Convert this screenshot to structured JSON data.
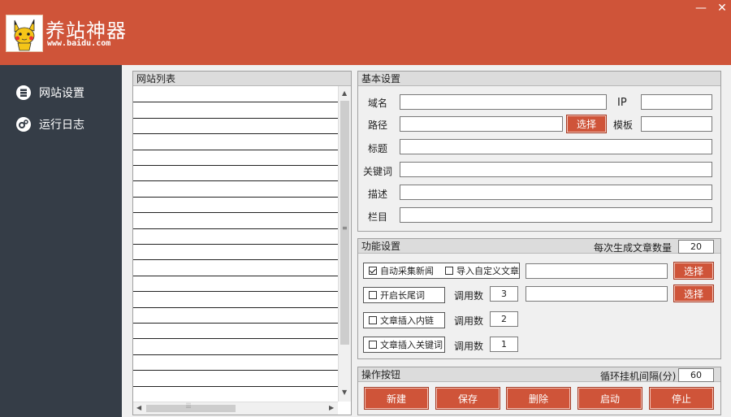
{
  "app": {
    "title": "养站神器",
    "url": "www.baidu.com",
    "minimize_glyph": "—",
    "close_glyph": "✕"
  },
  "sidebar": {
    "items": [
      {
        "label": "网站设置",
        "icon": "server-icon"
      },
      {
        "label": "运行日志",
        "icon": "gears-icon"
      }
    ]
  },
  "site_list": {
    "title": "网站列表",
    "row_count": 20
  },
  "basic": {
    "title": "基本设置",
    "domain_label": "域名",
    "domain_value": "",
    "ip_label": "IP",
    "ip_value": "",
    "path_label": "路径",
    "path_value": "",
    "select_label": "选择",
    "template_label": "模板",
    "template_value": "",
    "title_label": "标题",
    "title_value": "",
    "keywords_label": "关键词",
    "keywords_value": "",
    "desc_label": "描述",
    "desc_value": "",
    "column_label": "栏目",
    "column_value": ""
  },
  "func": {
    "title": "功能设置",
    "per_gen_label": "每次生成文章数量",
    "per_gen_value": "20",
    "auto_collect_label": "自动采集新闻",
    "auto_collect_checked": true,
    "import_custom_label": "导入自定义文章",
    "import_custom_checked": false,
    "select1_label": "选择",
    "select2_label": "选择",
    "longtail_label": "开启长尾词",
    "longtail_checked": false,
    "calls_label_1": "调用数",
    "calls_value_1": "3",
    "inner_link_label": "文章插入内链",
    "inner_link_checked": false,
    "calls_label_2": "调用数",
    "calls_value_2": "2",
    "insert_kw_label": "文章插入关键词",
    "insert_kw_checked": false,
    "calls_label_3": "调用数",
    "calls_value_3": "1"
  },
  "ops": {
    "title": "操作按钮",
    "interval_label": "循环挂机间隔(分)",
    "interval_value": "60",
    "buttons": [
      "新建",
      "保存",
      "删除",
      "启动",
      "停止"
    ]
  },
  "colors": {
    "accent": "#cf5439",
    "sidebar": "#353d47"
  }
}
